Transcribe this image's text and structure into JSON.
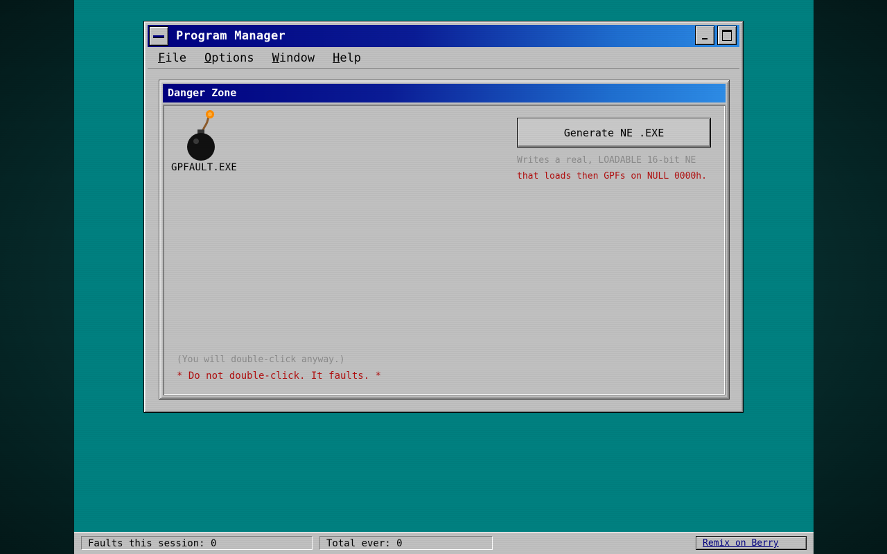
{
  "window": {
    "title": "Program Manager"
  },
  "menu": [
    {
      "first": "F",
      "rest": "ile"
    },
    {
      "first": "O",
      "rest": "ptions"
    },
    {
      "first": "W",
      "rest": "indow"
    },
    {
      "first": "H",
      "rest": "elp"
    }
  ],
  "group": {
    "title": "Danger Zone",
    "icon": {
      "name": "bomb-icon",
      "label": "GPFAULT.EXE"
    },
    "generate_button": "Generate NE .EXE",
    "description_line1": "Writes a real, LOADABLE 16-bit NE",
    "description_line2": "that loads then GPFs on NULL 0000h.",
    "note_anyway": "(You will double-click anyway.)",
    "warning": "* Do not double-click. It faults. *"
  },
  "statusbar": {
    "faults_session": "Faults this session: 0",
    "total_ever": "Total ever: 0",
    "remix_link": "Remix on Berry"
  },
  "colors": {
    "desktop": "#008080",
    "titlebar_start": "#000080",
    "titlebar_end": "#2d8ce6",
    "window_face": "#c0c0c0",
    "warning_red": "#b01010",
    "muted_gray": "#8a8a8a"
  }
}
